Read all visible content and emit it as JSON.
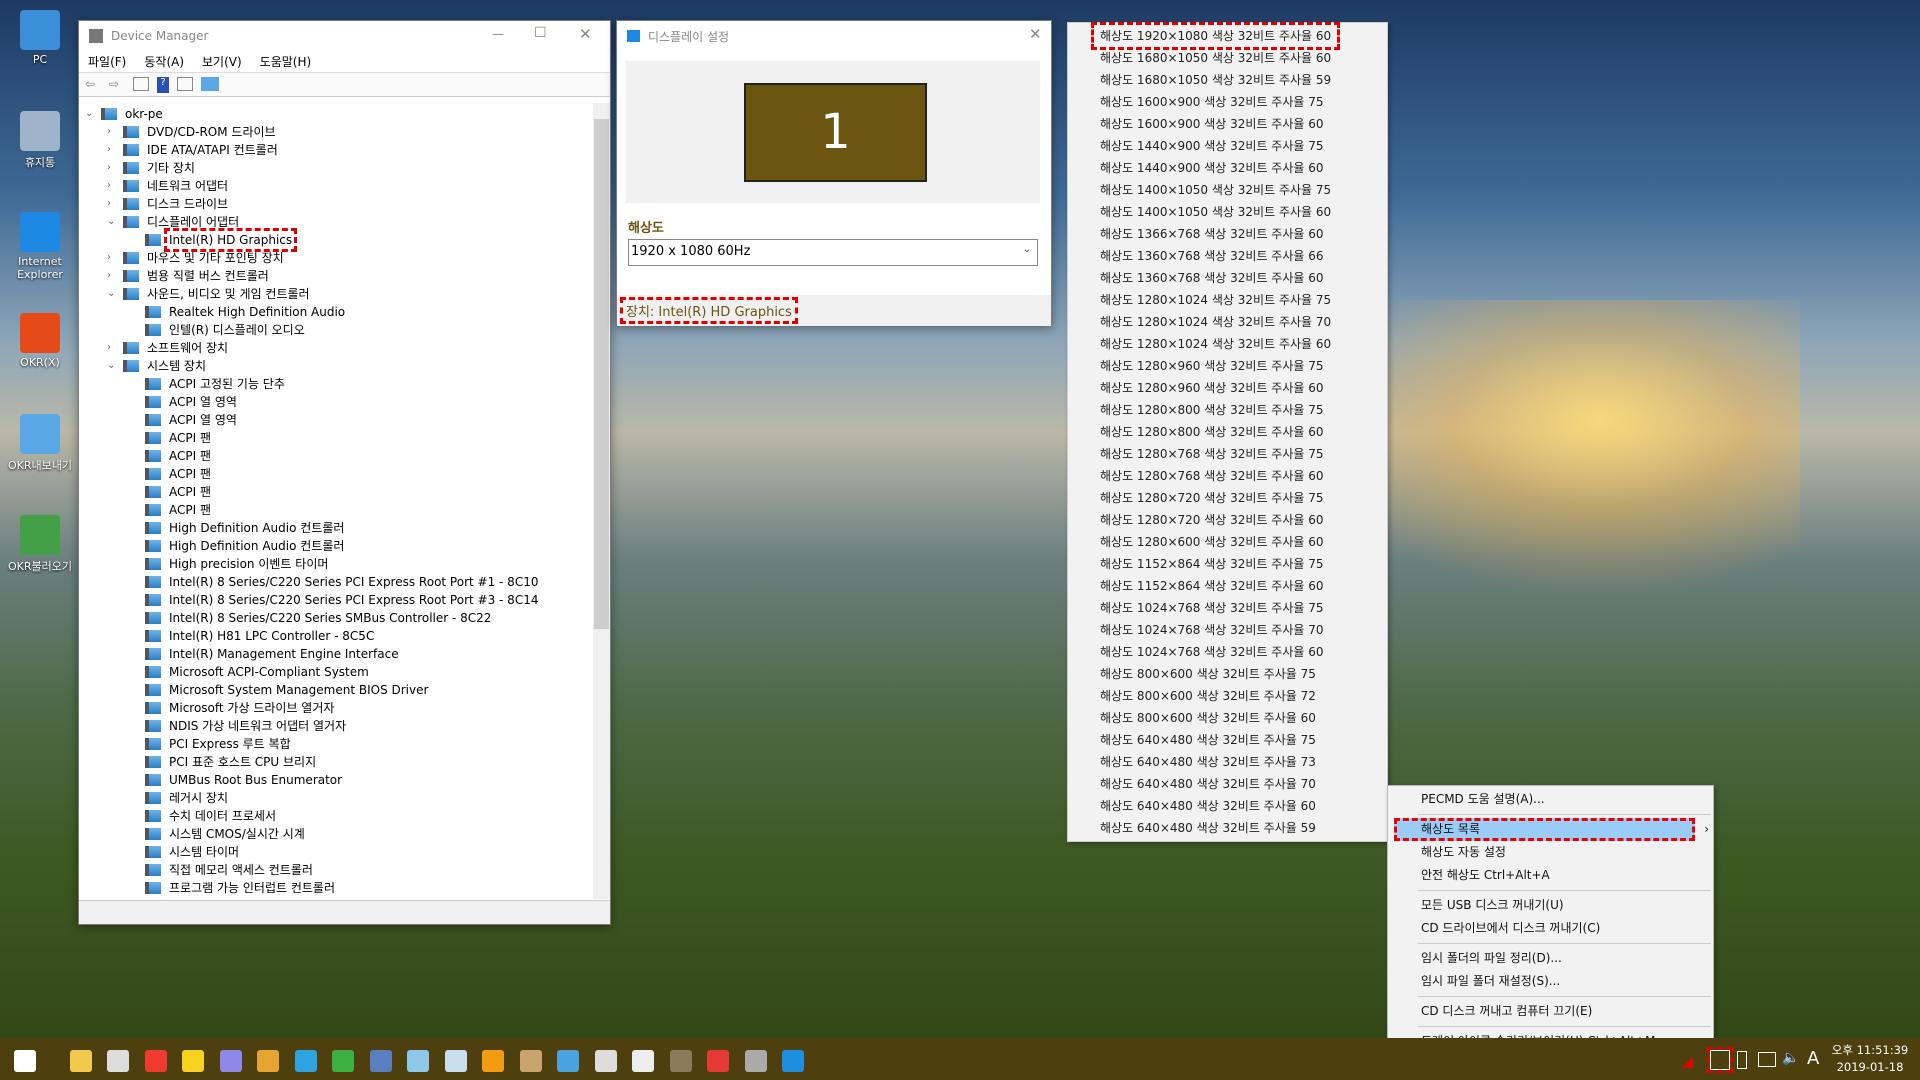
{
  "desktop": {
    "icons": [
      "PC",
      "휴지통",
      "Internet Explorer",
      "OKR(X)",
      "OKR내보내기",
      "OKR불러오기"
    ]
  },
  "device_manager": {
    "title": "Device Manager",
    "menu": [
      "파일(F)",
      "동작(A)",
      "보기(V)",
      "도움말(H)"
    ],
    "tree": [
      {
        "label": "okr-pe",
        "level": 0,
        "state": "open"
      },
      {
        "label": "DVD/CD-ROM 드라이브",
        "level": 1,
        "state": "closed"
      },
      {
        "label": "IDE ATA/ATAPI 컨트롤러",
        "level": 1,
        "state": "closed"
      },
      {
        "label": "기타 장치",
        "level": 1,
        "state": "closed"
      },
      {
        "label": "네트워크 어댑터",
        "level": 1,
        "state": "closed"
      },
      {
        "label": "디스크 드라이브",
        "level": 1,
        "state": "closed"
      },
      {
        "label": "디스플레이 어댑터",
        "level": 1,
        "state": "open"
      },
      {
        "label": "Intel(R) HD Graphics",
        "level": 2,
        "highlight": true
      },
      {
        "label": "마우스 및 기타 포인팅 장치",
        "level": 1,
        "state": "closed"
      },
      {
        "label": "범용 직렬 버스 컨트롤러",
        "level": 1,
        "state": "closed"
      },
      {
        "label": "사운드, 비디오 및 게임 컨트롤러",
        "level": 1,
        "state": "open"
      },
      {
        "label": "Realtek High Definition Audio",
        "level": 2
      },
      {
        "label": "인텔(R) 디스플레이 오디오",
        "level": 2
      },
      {
        "label": "소프트웨어 장치",
        "level": 1,
        "state": "closed"
      },
      {
        "label": "시스템 장치",
        "level": 1,
        "state": "open"
      },
      {
        "label": "ACPI 고정된 기능 단추",
        "level": 2
      },
      {
        "label": "ACPI 열 영역",
        "level": 2
      },
      {
        "label": "ACPI 열 영역",
        "level": 2
      },
      {
        "label": "ACPI 팬",
        "level": 2
      },
      {
        "label": "ACPI 팬",
        "level": 2
      },
      {
        "label": "ACPI 팬",
        "level": 2
      },
      {
        "label": "ACPI 팬",
        "level": 2
      },
      {
        "label": "ACPI 팬",
        "level": 2
      },
      {
        "label": "High Definition Audio 컨트롤러",
        "level": 2
      },
      {
        "label": "High Definition Audio 컨트롤러",
        "level": 2
      },
      {
        "label": "High precision 이벤트 타이머",
        "level": 2
      },
      {
        "label": "Intel(R) 8 Series/C220 Series PCI Express Root Port #1 - 8C10",
        "level": 2
      },
      {
        "label": "Intel(R) 8 Series/C220 Series PCI Express Root Port #3 - 8C14",
        "level": 2
      },
      {
        "label": "Intel(R) 8 Series/C220 Series SMBus Controller - 8C22",
        "level": 2
      },
      {
        "label": "Intel(R) H81 LPC Controller - 8C5C",
        "level": 2
      },
      {
        "label": "Intel(R) Management Engine Interface",
        "level": 2
      },
      {
        "label": "Microsoft ACPI-Compliant System",
        "level": 2
      },
      {
        "label": "Microsoft System Management BIOS Driver",
        "level": 2
      },
      {
        "label": "Microsoft 가상 드라이브 열거자",
        "level": 2
      },
      {
        "label": "NDIS 가상 네트워크 어댑터 열거자",
        "level": 2
      },
      {
        "label": "PCI Express 루트 복합",
        "level": 2
      },
      {
        "label": "PCI 표준 호스트 CPU 브리지",
        "level": 2
      },
      {
        "label": "UMBus Root Bus Enumerator",
        "level": 2
      },
      {
        "label": "레거시 장치",
        "level": 2
      },
      {
        "label": "수치 데이터 프로세서",
        "level": 2
      },
      {
        "label": "시스템 CMOS/실시간 시계",
        "level": 2
      },
      {
        "label": "시스템 타이머",
        "level": 2
      },
      {
        "label": "직접 메모리 액세스 컨트롤러",
        "level": 2
      },
      {
        "label": "프로그램 가능 인터럽트 컨트롤러",
        "level": 2
      }
    ]
  },
  "display_settings": {
    "title": "디스플레이 설정",
    "monitor_number": "1",
    "monitor_color": "#6b5510",
    "resolution_label": "해상도",
    "resolution_value": "1920 x 1080 60Hz",
    "device_label": "장치: Intel(R) HD Graphics"
  },
  "resolution_list": [
    "해상도 1920×1080 색상 32비트 주사율 60",
    "해상도 1680×1050 색상 32비트 주사율 60",
    "해상도 1680×1050 색상 32비트 주사율 59",
    "해상도 1600×900 색상 32비트 주사율 75",
    "해상도 1600×900 색상 32비트 주사율 60",
    "해상도 1440×900 색상 32비트 주사율 75",
    "해상도 1440×900 색상 32비트 주사율 60",
    "해상도 1400×1050 색상 32비트 주사율 75",
    "해상도 1400×1050 색상 32비트 주사율 60",
    "해상도 1366×768 색상 32비트 주사율 60",
    "해상도 1360×768 색상 32비트 주사율 66",
    "해상도 1360×768 색상 32비트 주사율 60",
    "해상도 1280×1024 색상 32비트 주사율 75",
    "해상도 1280×1024 색상 32비트 주사율 70",
    "해상도 1280×1024 색상 32비트 주사율 60",
    "해상도 1280×960 색상 32비트 주사율 75",
    "해상도 1280×960 색상 32비트 주사율 60",
    "해상도 1280×800 색상 32비트 주사율 75",
    "해상도 1280×800 색상 32비트 주사율 60",
    "해상도 1280×768 색상 32비트 주사율 75",
    "해상도 1280×768 색상 32비트 주사율 60",
    "해상도 1280×720 색상 32비트 주사율 75",
    "해상도 1280×720 색상 32비트 주사율 60",
    "해상도 1280×600 색상 32비트 주사율 60",
    "해상도 1152×864 색상 32비트 주사율 75",
    "해상도 1152×864 색상 32비트 주사율 60",
    "해상도 1024×768 색상 32비트 주사율 75",
    "해상도 1024×768 색상 32비트 주사율 70",
    "해상도 1024×768 색상 32비트 주사율 60",
    "해상도 800×600 색상 32비트 주사율 75",
    "해상도 800×600 색상 32비트 주사율 72",
    "해상도 800×600 색상 32비트 주사율 60",
    "해상도 640×480 색상 32비트 주사율 75",
    "해상도 640×480 색상 32비트 주사율 73",
    "해상도 640×480 색상 32비트 주사율 70",
    "해상도 640×480 색상 32비트 주사율 60",
    "해상도 640×480 색상 32비트 주사율 59"
  ],
  "context_menu": {
    "groups": [
      [
        "PECMD 도움 설명(A)..."
      ],
      [
        "해상도 목록",
        "해상도 자동 설정",
        "안전 해상도 Ctrl+Alt+A"
      ],
      [
        "모든 USB 디스크 꺼내기(U)",
        "CD 드라이브에서 디스크 꺼내기(C)"
      ],
      [
        "임시 폴더의 파일 정리(D)...",
        "임시 파일 폴더 재설정(S)..."
      ],
      [
        "CD 디스크 꺼내고 컴퓨터 끄기(E)"
      ],
      [
        "트레이 아이콘 숨기기/보이기(H) Ctrl+Alt+M"
      ]
    ],
    "highlighted": "해상도 목록",
    "highlight_color": "#99ccf7"
  },
  "taskbar": {
    "color": "#4d3f0e",
    "icons": [
      "start-icon",
      "file-explorer-icon",
      "capture-icon",
      "anydesk-icon",
      "potplayer-icon",
      "disk-icon",
      "partition-icon",
      "butterfly-icon",
      "chrome-like-icon",
      "network-tool-icon",
      "notepad-icon",
      "media-icon",
      "p-icon",
      "installer-icon",
      "remote-icon",
      "tools-icon",
      "checklist-icon",
      "grid-tool-icon",
      "close-red-icon",
      "device-manager-icon",
      "display-settings-icon"
    ],
    "tray_ime": "A",
    "clock_time": "오후 11:51:39",
    "clock_date": "2019-01-18"
  }
}
